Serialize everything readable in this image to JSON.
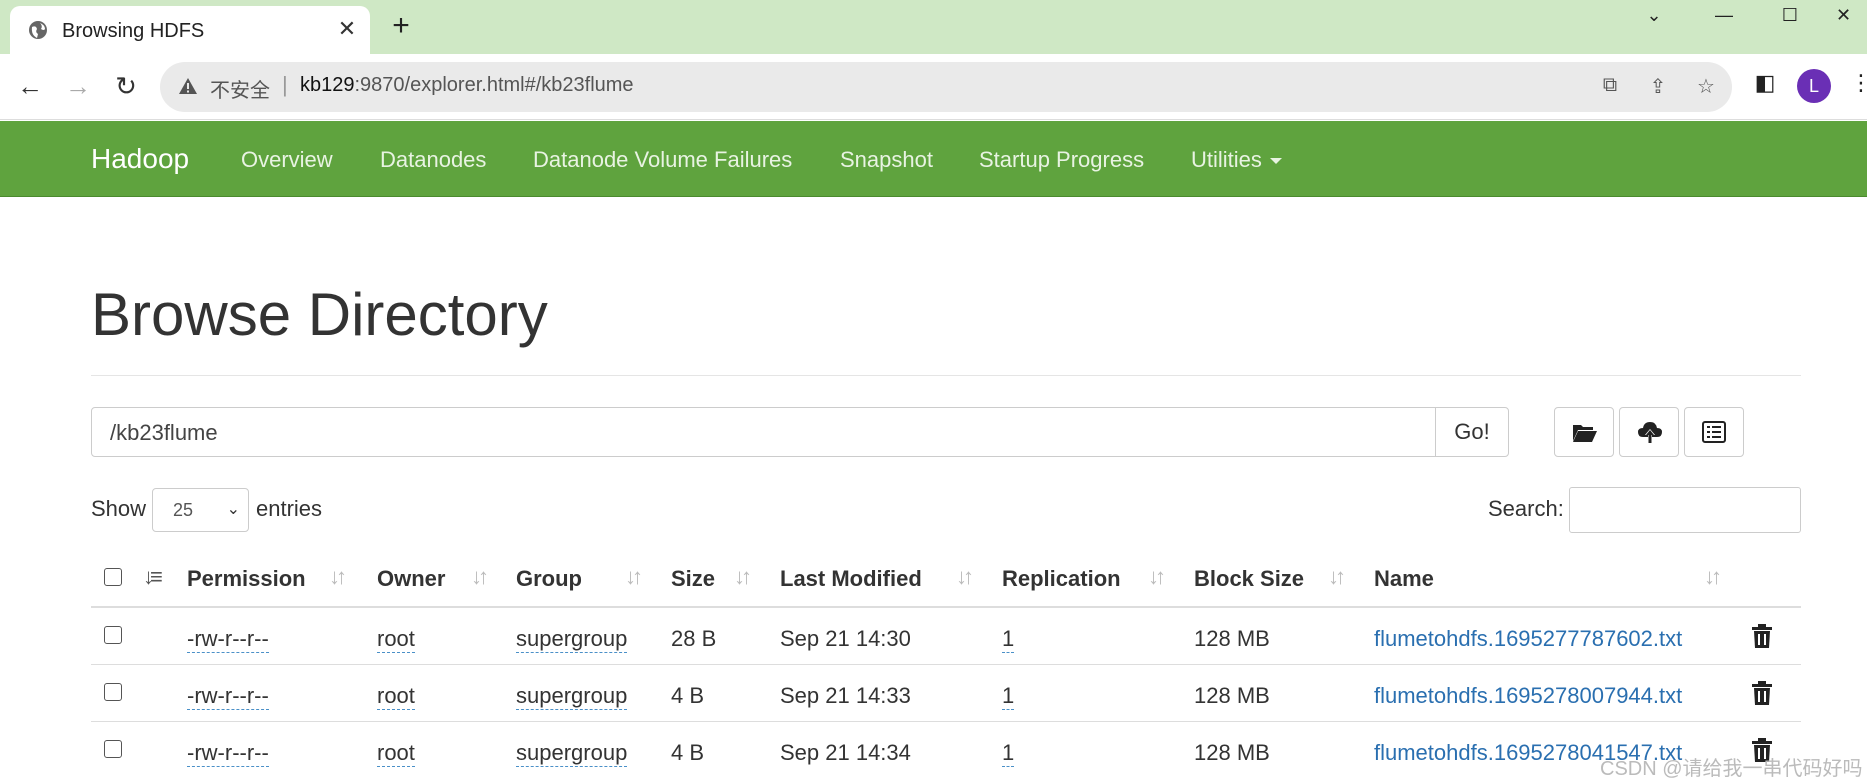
{
  "browser": {
    "tab_title": "Browsing HDFS",
    "omnibox_insecure": "不安全",
    "url_host": "kb129",
    "url_rest": ":9870/explorer.html#/kb23flume",
    "avatar_letter": "L"
  },
  "navbar": {
    "brand": "Hadoop",
    "items": [
      "Overview",
      "Datanodes",
      "Datanode Volume Failures",
      "Snapshot",
      "Startup Progress",
      "Utilities"
    ]
  },
  "page": {
    "title": "Browse Directory",
    "path_value": "/kb23flume",
    "go_label": "Go!",
    "show_label": "Show",
    "entries_value": "25",
    "entries_label": "entries",
    "search_label": "Search:"
  },
  "table": {
    "columns": [
      "Permission",
      "Owner",
      "Group",
      "Size",
      "Last Modified",
      "Replication",
      "Block Size",
      "Name"
    ],
    "rows": [
      {
        "permission": "-rw-r--r--",
        "owner": "root",
        "group": "supergroup",
        "size": "28 B",
        "modified": "Sep 21 14:30",
        "replication": "1",
        "block_size": "128 MB",
        "name": "flumetohdfs.1695277787602.txt"
      },
      {
        "permission": "-rw-r--r--",
        "owner": "root",
        "group": "supergroup",
        "size": "4 B",
        "modified": "Sep 21 14:33",
        "replication": "1",
        "block_size": "128 MB",
        "name": "flumetohdfs.1695278007944.txt"
      },
      {
        "permission": "-rw-r--r--",
        "owner": "root",
        "group": "supergroup",
        "size": "4 B",
        "modified": "Sep 21 14:34",
        "replication": "1",
        "block_size": "128 MB",
        "name": "flumetohdfs.1695278041547.txt"
      }
    ]
  },
  "watermark": "CSDN @请给我一串代码好吗",
  "colors": {
    "navbar": "#5fa33e",
    "tabstrip": "#cfe8c5",
    "link": "#2a6fb0"
  }
}
